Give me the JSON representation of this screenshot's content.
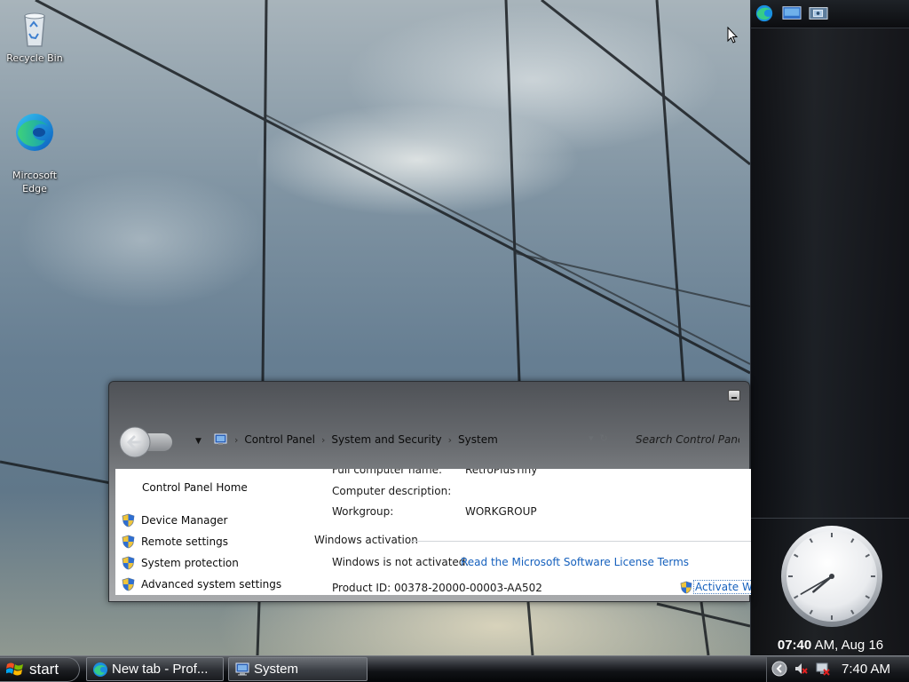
{
  "desktop": {
    "icons": [
      {
        "label": "Recycle Bin",
        "icon": "recycle-bin-icon"
      },
      {
        "label": "Mircosoft\nEdge",
        "icon": "edge-icon"
      }
    ]
  },
  "sidebar": {
    "buttons": [
      "edge-icon",
      "desktop-icon",
      "window-switch-icon"
    ],
    "clock_time_bold": "07:40",
    "clock_time_rest": " AM, Aug 16",
    "analog_clock": {
      "hour": 7,
      "minute": 40
    }
  },
  "window": {
    "title": "System",
    "breadcrumb": [
      "Control Panel",
      "System and Security",
      "System"
    ],
    "search_placeholder": "Search Control Panel",
    "left_pane": {
      "home_link": "Control Panel Home",
      "tasks": [
        "Device Manager",
        "Remote settings",
        "System protection",
        "Advanced system settings"
      ]
    },
    "computer": {
      "rows": [
        {
          "label": "Full computer name:",
          "value": "RetroPlusTiny"
        },
        {
          "label": "Computer description:",
          "value": ""
        },
        {
          "label": "Workgroup:",
          "value": "WORKGROUP"
        }
      ]
    },
    "activation": {
      "heading": "Windows activation",
      "status": "Windows is not activated.",
      "license_link": "Read the Microsoft Software License Terms",
      "product_id": "Product ID:  00378-20000-00003-AA502",
      "activate_link": "Activate Windows now"
    }
  },
  "taskbar": {
    "start_label": "start",
    "buttons": [
      {
        "label": "New tab - Prof...",
        "icon": "edge-icon"
      },
      {
        "label": "System",
        "icon": "system-icon"
      }
    ],
    "tray": {
      "time": "7:40 AM",
      "icons": [
        "chevron-left-icon",
        "volume-muted-icon",
        "network-disconnected-icon"
      ]
    }
  },
  "colors": {
    "link": "#1560bd",
    "window_glass": "#6a6d71",
    "taskbar": "#101216"
  }
}
